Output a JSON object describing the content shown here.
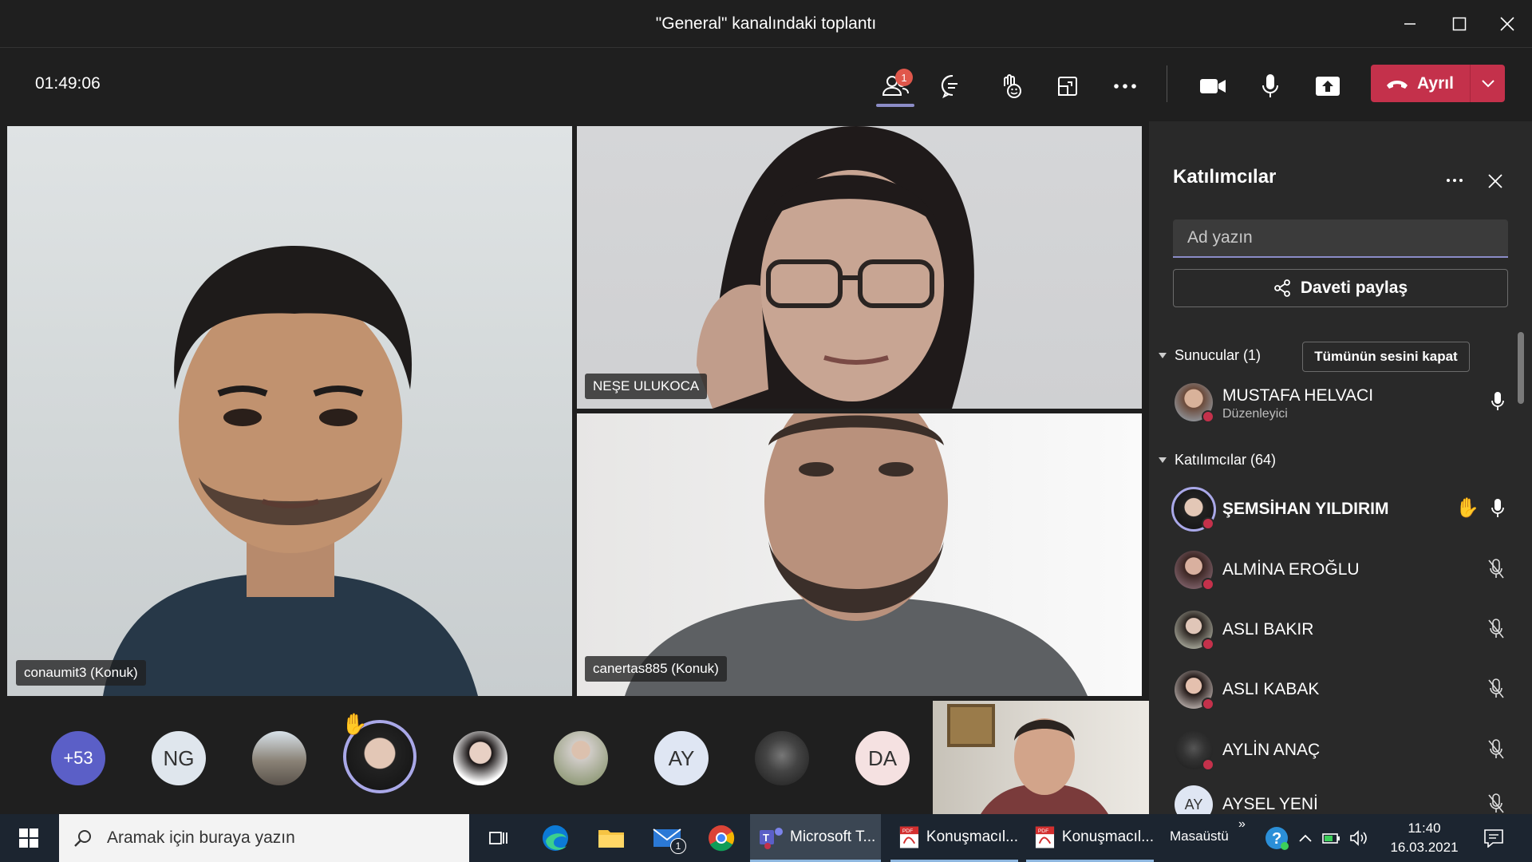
{
  "window": {
    "title": "\"General\" kanalındaki toplantı"
  },
  "toolbar": {
    "timer": "01:49:06",
    "participants_badge": "1",
    "leave_label": "Ayrıl"
  },
  "videos": [
    {
      "name": "conaumit3 (Konuk)"
    },
    {
      "name": "NEŞE ULUKOCA"
    },
    {
      "name": "canertas885 (Konuk)"
    }
  ],
  "gallery": {
    "more_count": "+53",
    "initials": [
      "NG",
      "AY",
      "DA"
    ]
  },
  "panel": {
    "title": "Katılımcılar",
    "search_placeholder": "Ad yazın",
    "invite_label": "Daveti paylaş",
    "presenters_label": "Sunucular (1)",
    "mute_all_label": "Tümünün sesini kapat",
    "attendees_label": "Katılımcılar (64)",
    "presenter": {
      "name": "MUSTAFA HELVACI",
      "role": "Düzenleyici"
    },
    "attendees": [
      {
        "name": "ŞEMSİHAN YILDIRIM",
        "initials": ""
      },
      {
        "name": "ALMİNA EROĞLU",
        "initials": ""
      },
      {
        "name": "ASLI BAKIR",
        "initials": ""
      },
      {
        "name": "ASLI KABAK",
        "initials": ""
      },
      {
        "name": "AYLİN ANAÇ",
        "initials": ""
      },
      {
        "name": "AYSEL YENİ",
        "initials": "AY"
      }
    ]
  },
  "taskbar": {
    "search_placeholder": "Aramak için buraya yazın",
    "mail_badge": "1",
    "apps": [
      {
        "label": "Microsoft T..."
      },
      {
        "label": "Konuşmacıl..."
      },
      {
        "label": "Konuşmacıl..."
      }
    ],
    "desktop_label": "Masaüstü",
    "time": "11:40",
    "date": "16.03.2021"
  },
  "colors": {
    "accent": "#8b8cc7",
    "leave_red": "#c4314b",
    "panel_bg": "#292929",
    "bg": "#1f1f1f"
  },
  "icons": [
    "participants-icon",
    "chat-icon",
    "raise-hand-icon",
    "layout-icon",
    "more-icon",
    "camera-icon",
    "mic-icon",
    "share-icon",
    "phone-icon"
  ]
}
